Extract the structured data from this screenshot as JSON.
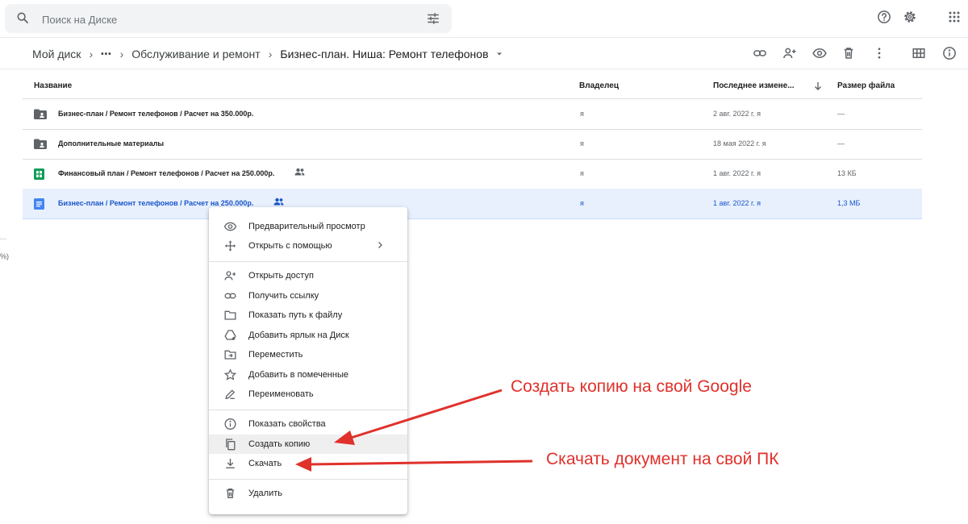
{
  "search": {
    "placeholder": "Поиск на Диске"
  },
  "breadcrumb": {
    "root": "Мой диск",
    "more": "•••",
    "folder": "Обслуживание и ремонт",
    "current": "Бизнес-план. Ниша: Ремонт телефонов"
  },
  "columns": {
    "name": "Название",
    "owner": "Владелец",
    "modified": "Последнее измене...",
    "size": "Размер файла"
  },
  "files": [
    {
      "icon": "folder-shared-icon",
      "name": "Бизнес-план / Ремонт телефонов / Расчет на 350.000р.",
      "owner": "я",
      "modified": "2 авг. 2022 г. я",
      "size": "—"
    },
    {
      "icon": "folder-shared-icon",
      "name": "Дополнительные материалы",
      "owner": "я",
      "modified": "18 мая 2022 г. я",
      "size": "—"
    },
    {
      "icon": "google-sheets-icon",
      "name": "Финансовый план / Ремонт телефонов / Расчет на 250.000р.",
      "owner": "я",
      "modified": "1 авг. 2022 г. я",
      "size": "13 КБ"
    },
    {
      "icon": "google-docs-icon",
      "name": "Бизнес-план / Ремонт телефонов / Расчет на 250.000р.",
      "owner": "я",
      "modified": "1 авг. 2022 г. я",
      "size": "1,3 МБ"
    }
  ],
  "left_edge_text": "%)",
  "context_menu": {
    "preview": "Предварительный просмотр",
    "open_with": "Открыть с помощью",
    "share": "Открыть доступ",
    "get_link": "Получить ссылку",
    "show_location": "Показать путь к файлу",
    "add_shortcut": "Добавить ярлык на Диск",
    "move": "Переместить",
    "star": "Добавить в помеченные",
    "rename": "Переименовать",
    "details": "Показать свойства",
    "make_copy": "Создать копию",
    "download": "Скачать",
    "delete": "Удалить"
  },
  "annotations": {
    "copy_note": "Создать копию на свой Google",
    "download_note": "Скачать документ на свой ПК"
  },
  "colors": {
    "selected_row": "#e8f0fe",
    "selected_text": "#1a56c9",
    "annotation": "#e0312b",
    "sheets_green": "#0f9d58",
    "docs_blue": "#4285f4"
  }
}
